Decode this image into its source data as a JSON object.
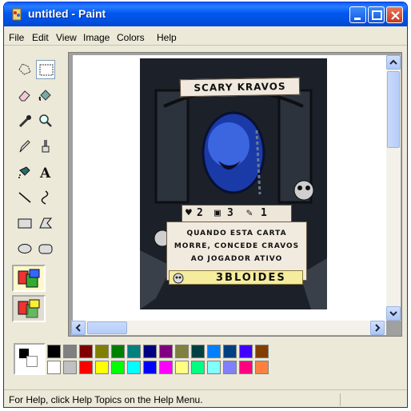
{
  "window": {
    "title": "untitled - Paint"
  },
  "menu": [
    "File",
    "Edit",
    "View",
    "Image",
    "Colors",
    "Help"
  ],
  "tools": [
    "free-form-select",
    "select",
    "eraser",
    "fill-with-color",
    "pick-color",
    "magnifier",
    "pencil",
    "brush",
    "airbrush",
    "text",
    "line",
    "curve",
    "rectangle",
    "polygon",
    "ellipse",
    "rounded-rectangle"
  ],
  "card": {
    "title": "SCARY KRAVOS",
    "stats": {
      "life": "2",
      "shield": "3",
      "attack": "1"
    },
    "description": [
      "QUANDO ESTA CARTA",
      "MORRE, CONCEDE CRAVOS",
      "AO JOGADOR ATIVO"
    ],
    "tribe": "3BLOIDES"
  },
  "palette": {
    "top": [
      "#000000",
      "#808080",
      "#800000",
      "#808000",
      "#008000",
      "#008080",
      "#000080",
      "#800080",
      "#808040",
      "#004040",
      "#0080ff",
      "#004080",
      "#4000ff",
      "#804000"
    ],
    "bottom": [
      "#ffffff",
      "#c0c0c0",
      "#ff0000",
      "#ffff00",
      "#00ff00",
      "#00ffff",
      "#0000ff",
      "#ff00ff",
      "#ffff80",
      "#00ff80",
      "#80ffff",
      "#8080ff",
      "#ff0080",
      "#ff8040"
    ]
  },
  "status": {
    "text": "For Help, click Help Topics on the Help Menu."
  }
}
